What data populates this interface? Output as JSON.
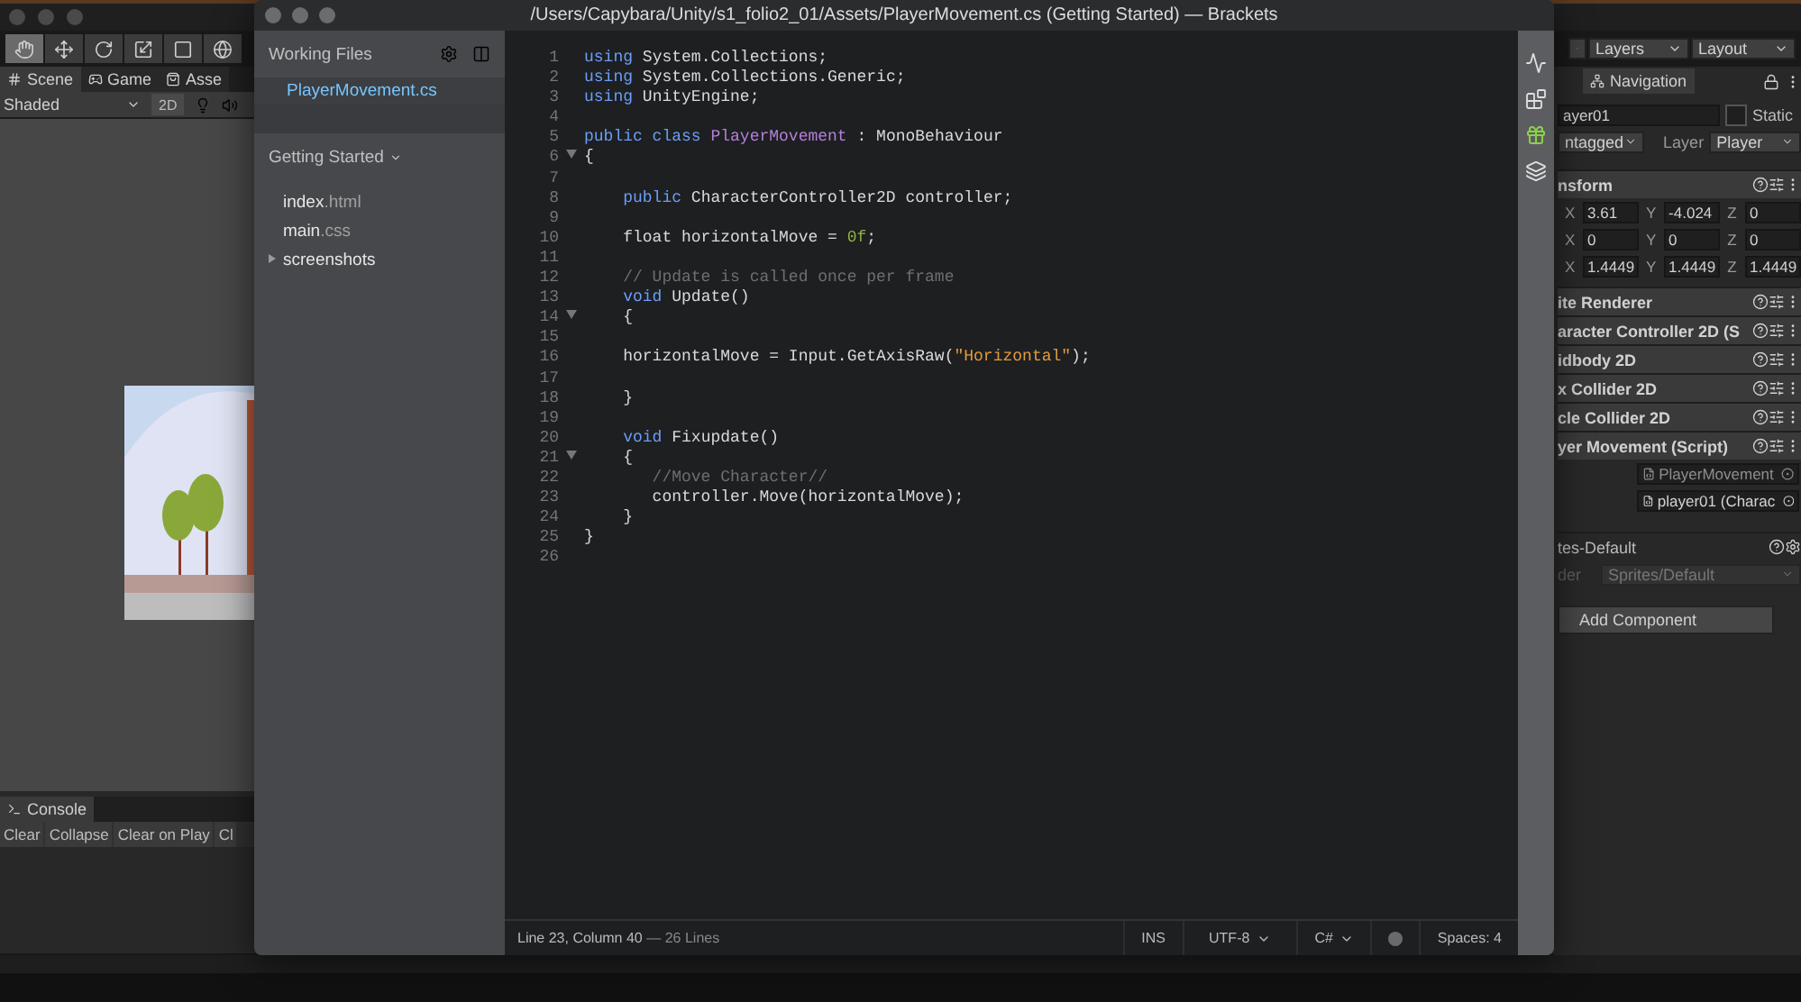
{
  "unity": {
    "tabs": [
      {
        "label": "Scene",
        "selected": true
      },
      {
        "label": "Game",
        "selected": false
      },
      {
        "label": "Asse",
        "selected": false
      }
    ],
    "scene_toolbar": {
      "shading": "Shaded",
      "mode_2d": "2D"
    },
    "console": {
      "tab": "Console",
      "buttons": [
        "Clear",
        "Collapse",
        "Clear on Play",
        "Cl"
      ]
    },
    "top_right": {
      "layers": "Layers",
      "layout": "Layout"
    },
    "inspector": {
      "tab": "Navigation",
      "name": "ayer01",
      "static_checked": false,
      "static": "Static",
      "tag": "ntagged",
      "layer_label": "Layer",
      "layer": "Player",
      "transform": {
        "title": "nsform",
        "rows": [
          [
            {
              "axis": "X",
              "value": "3.61"
            },
            {
              "axis": "Y",
              "value": "-4.024"
            },
            {
              "axis": "Z",
              "value": "0"
            }
          ],
          [
            {
              "axis": "X",
              "value": "0"
            },
            {
              "axis": "Y",
              "value": "0"
            },
            {
              "axis": "Z",
              "value": "0"
            }
          ],
          [
            {
              "axis": "X",
              "value": "1.4449"
            },
            {
              "axis": "Y",
              "value": "1.4449"
            },
            {
              "axis": "Z",
              "value": "1.4449"
            }
          ]
        ]
      },
      "components": [
        "ite Renderer",
        "aracter Controller 2D (S",
        "idbody 2D",
        "x Collider 2D",
        "cle Collider 2D",
        "yer Movement (Script)"
      ],
      "script_fields": [
        {
          "value": "PlayerMovement",
          "disabled": true
        },
        {
          "value": "player01 (Charac",
          "disabled": false
        }
      ],
      "material": {
        "title": "tes-Default",
        "shader_label": "der",
        "shader": "Sprites/Default",
        "disabled": true
      },
      "add_component": "Add Component"
    }
  },
  "brackets": {
    "title": "/Users/Capybara/Unity/s1_folio2_01/Assets/PlayerMovement.cs (Getting Started) — Brackets",
    "working_files": {
      "heading": "Working Files",
      "files": [
        {
          "name": "PlayerMovement.cs",
          "selected": true
        }
      ]
    },
    "project": {
      "name": "Getting Started",
      "items": [
        {
          "kind": "file",
          "base": "index",
          "ext": ".html"
        },
        {
          "kind": "file",
          "base": "main",
          "ext": ".css"
        },
        {
          "kind": "folder",
          "base": "screenshots"
        }
      ]
    },
    "code": [
      {
        "number": "1",
        "fold": false,
        "tokens": [
          {
            "kind": "keyword",
            "text": "using"
          },
          {
            "kind": "plain",
            "text": " System.Collections;"
          }
        ]
      },
      {
        "number": "2",
        "fold": false,
        "tokens": [
          {
            "kind": "keyword",
            "text": "using"
          },
          {
            "kind": "plain",
            "text": " System.Collections.Generic;"
          }
        ]
      },
      {
        "number": "3",
        "fold": false,
        "tokens": [
          {
            "kind": "keyword",
            "text": "using"
          },
          {
            "kind": "plain",
            "text": " UnityEngine;"
          }
        ]
      },
      {
        "number": "4",
        "fold": false
      },
      {
        "number": "5",
        "fold": false,
        "tokens": [
          {
            "kind": "keyword",
            "text": "public class "
          },
          {
            "kind": "definition",
            "text": "PlayerMovement"
          },
          {
            "kind": "plain",
            "text": " : MonoBehaviour"
          }
        ]
      },
      {
        "number": "6",
        "fold": true,
        "tokens": [
          {
            "kind": "plain",
            "text": "{"
          }
        ]
      },
      {
        "number": "7",
        "fold": false
      },
      {
        "number": "8",
        "fold": false,
        "tokens": [
          {
            "kind": "keyword",
            "text": "    public"
          },
          {
            "kind": "plain",
            "text": " CharacterController2D controller;"
          }
        ]
      },
      {
        "number": "9",
        "fold": false
      },
      {
        "number": "10",
        "fold": false,
        "tokens": [
          {
            "kind": "plain",
            "text": "    float horizontalMove = "
          },
          {
            "kind": "number",
            "text": "0f"
          },
          {
            "kind": "plain",
            "text": ";"
          }
        ]
      },
      {
        "number": "11",
        "fold": false
      },
      {
        "number": "12",
        "fold": false,
        "tokens": [
          {
            "kind": "comment",
            "text": "    // Update is called once per frame"
          }
        ]
      },
      {
        "number": "13",
        "fold": false,
        "tokens": [
          {
            "kind": "keyword",
            "text": "    void"
          },
          {
            "kind": "plain",
            "text": " Update()"
          }
        ]
      },
      {
        "number": "14",
        "fold": true,
        "tokens": [
          {
            "kind": "plain",
            "text": "    {"
          }
        ]
      },
      {
        "number": "15",
        "fold": false
      },
      {
        "number": "16",
        "fold": false,
        "tokens": [
          {
            "kind": "plain",
            "text": "    horizontalMove = Input.GetAxisRaw("
          },
          {
            "kind": "string",
            "text": "\"Horizontal\""
          },
          {
            "kind": "plain",
            "text": ");"
          }
        ]
      },
      {
        "number": "17",
        "fold": false
      },
      {
        "number": "18",
        "fold": false,
        "tokens": [
          {
            "kind": "plain",
            "text": "    }"
          }
        ]
      },
      {
        "number": "19",
        "fold": false
      },
      {
        "number": "20",
        "fold": false,
        "tokens": [
          {
            "kind": "keyword",
            "text": "    void"
          },
          {
            "kind": "plain",
            "text": " Fixupdate()"
          }
        ]
      },
      {
        "number": "21",
        "fold": true,
        "tokens": [
          {
            "kind": "plain",
            "text": "    {"
          }
        ]
      },
      {
        "number": "22",
        "fold": false,
        "tokens": [
          {
            "kind": "comment",
            "text": "       //Move Character//"
          }
        ]
      },
      {
        "number": "23",
        "fold": false,
        "tokens": [
          {
            "kind": "plain",
            "text": "       controller.Move(horizontalMove);"
          }
        ]
      },
      {
        "number": "24",
        "fold": false,
        "tokens": [
          {
            "kind": "plain",
            "text": "    }"
          }
        ]
      },
      {
        "number": "25",
        "fold": false,
        "tokens": [
          {
            "kind": "plain",
            "text": "}"
          }
        ]
      },
      {
        "number": "26",
        "fold": false
      }
    ],
    "status_bar": {
      "position": "Line 23, Column 40",
      "lines": "— 26 Lines",
      "mode": "INS",
      "encoding": "UTF-8",
      "language": "C#",
      "spaces": "Spaces: 4"
    }
  }
}
